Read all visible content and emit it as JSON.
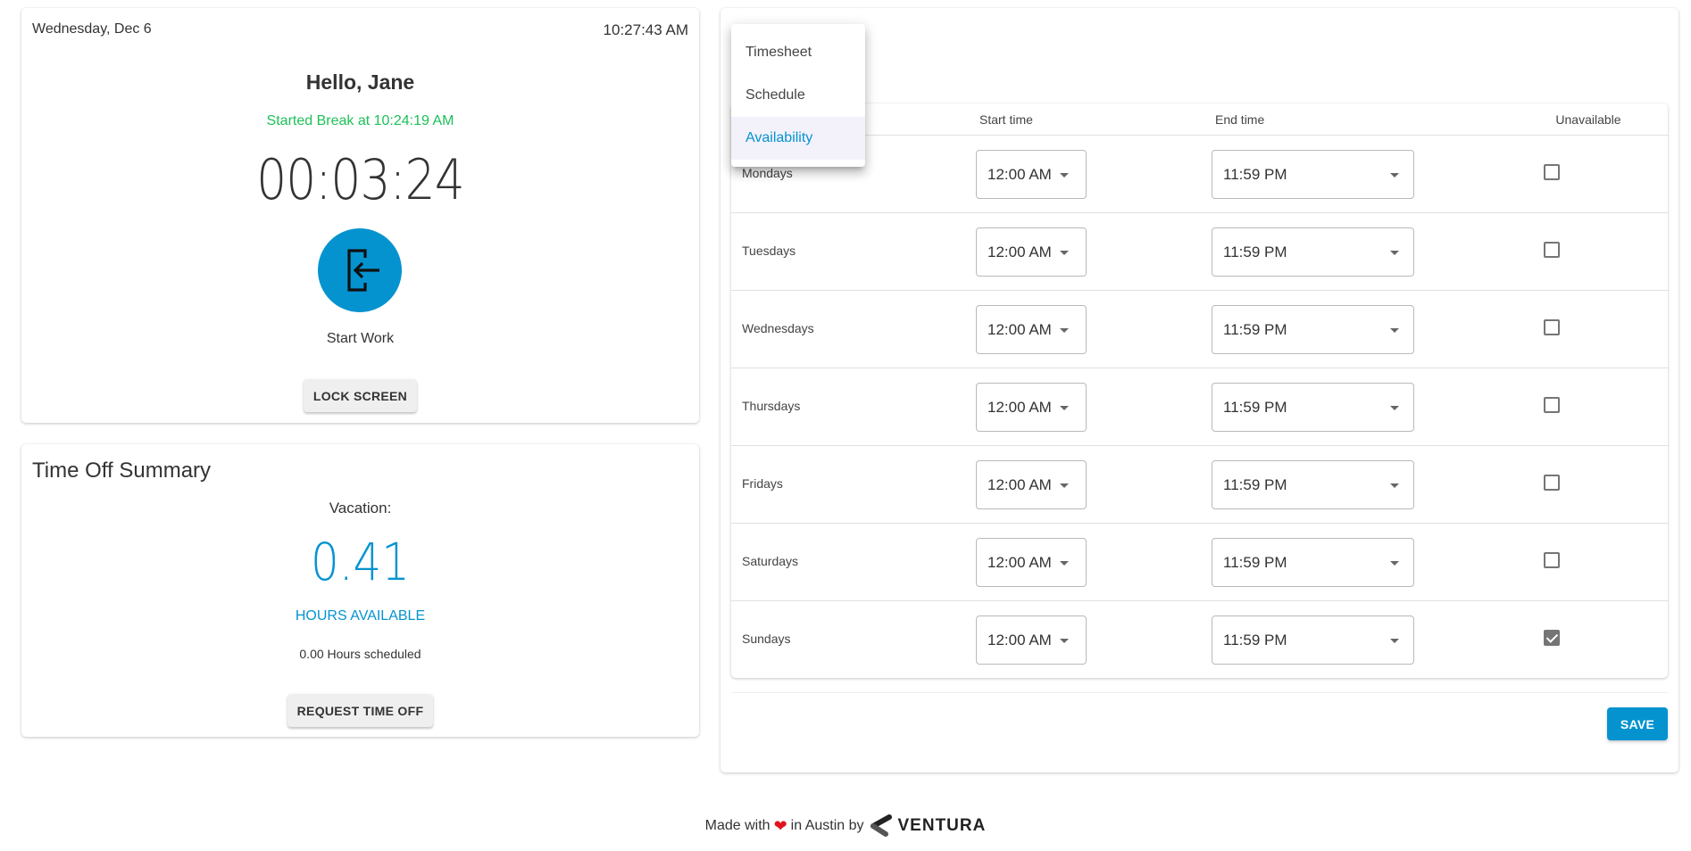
{
  "clock": {
    "date": "Wednesday, Dec 6",
    "time": "10:27:43 AM",
    "greeting": "Hello, Jane",
    "status": "Started Break at 10:24:19 AM",
    "timer": "00:03:24",
    "punch_icon": "login-arrow-icon",
    "punch_label": "Start Work",
    "lock_button": "LOCK SCREEN"
  },
  "time_off": {
    "title": "Time Off Summary",
    "type_label": "Vacation:",
    "hours_value": "0.41",
    "hours_unit": "HOURS AVAILABLE",
    "scheduled": "0.00 Hours scheduled",
    "request_button": "REQUEST TIME OFF"
  },
  "menu": {
    "items": [
      {
        "label": "Timesheet",
        "selected": false
      },
      {
        "label": "Schedule",
        "selected": false
      },
      {
        "label": "Availability",
        "selected": true
      }
    ]
  },
  "availability": {
    "headers": {
      "start": "Start time",
      "end": "End time",
      "unavailable": "Unavailable"
    },
    "rows": [
      {
        "day": "Mondays",
        "start": "12:00 AM",
        "end": "11:59 PM",
        "unavailable": false
      },
      {
        "day": "Tuesdays",
        "start": "12:00 AM",
        "end": "11:59 PM",
        "unavailable": false
      },
      {
        "day": "Wednesdays",
        "start": "12:00 AM",
        "end": "11:59 PM",
        "unavailable": false
      },
      {
        "day": "Thursdays",
        "start": "12:00 AM",
        "end": "11:59 PM",
        "unavailable": false
      },
      {
        "day": "Fridays",
        "start": "12:00 AM",
        "end": "11:59 PM",
        "unavailable": false
      },
      {
        "day": "Saturdays",
        "start": "12:00 AM",
        "end": "11:59 PM",
        "unavailable": false
      },
      {
        "day": "Sundays",
        "start": "12:00 AM",
        "end": "11:59 PM",
        "unavailable": true
      }
    ],
    "save_button": "SAVE"
  },
  "footer": {
    "made_with": "Made with",
    "heart": "❤",
    "in_city": "in Austin by",
    "brand": "VENTURA"
  },
  "colors": {
    "accent": "#0593d0",
    "status_green": "#1dc159",
    "menu_selected_bg": "#f3f2fb"
  }
}
